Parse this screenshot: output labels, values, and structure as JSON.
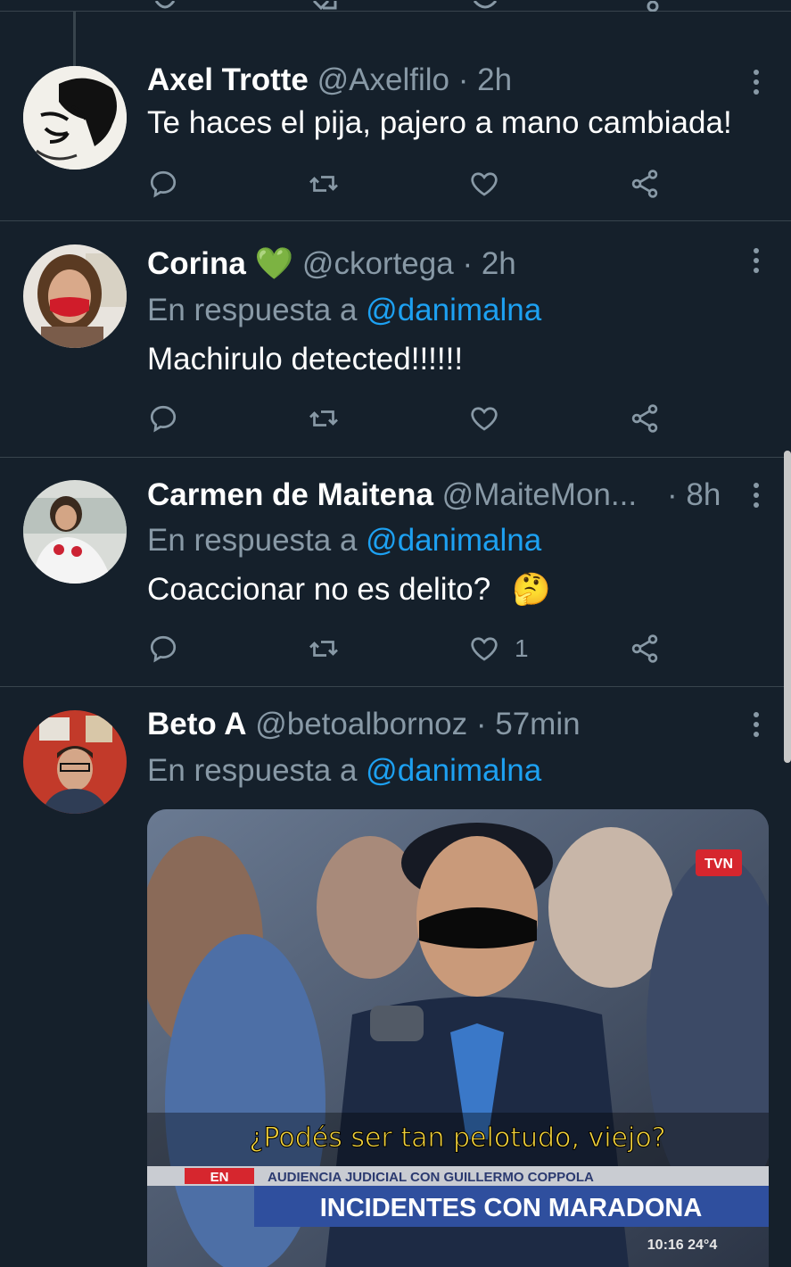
{
  "tweets": [
    {
      "name": "Axel Trotte",
      "handle": "@Axelfilo",
      "time": "· 2h",
      "text": "Te haces el pija, pajero a mano cambiada!",
      "likes": ""
    },
    {
      "name": "Corina",
      "badge": "💚",
      "handle": "@ckortega",
      "time": "· 2h",
      "reply_prefix": "En respuesta a",
      "reply_to": "@danimalna",
      "text": "Machirulo detected!!!!!!",
      "likes": ""
    },
    {
      "name": "Carmen de Maitena",
      "handle": "@MaiteMon...",
      "time": "· 8h",
      "reply_prefix": "En respuesta a",
      "reply_to": "@danimalna",
      "text": "Coaccionar no es delito?",
      "emoji": "🤔",
      "likes": "1"
    },
    {
      "name": "Beto A",
      "handle": "@betoalbornoz",
      "time": "· 57min",
      "reply_prefix": "En respuesta a",
      "reply_to": "@danimalna",
      "media": {
        "channel_logo": "TVN",
        "subtitle": "¿Podés ser tan pelotudo, viejo?",
        "ticker_source": "EN",
        "ticker_line1": "AUDIENCIA JUDICIAL CON GUILLERMO COPPOLA",
        "ticker_line2": "INCIDENTES CON MARADONA",
        "clock": "10:16  24°4"
      }
    }
  ],
  "icons": [
    "reply-icon",
    "retweet-icon",
    "like-icon",
    "share-icon",
    "more-icon"
  ],
  "colors": {
    "background": "#15202b",
    "secondary_text": "#8899a6",
    "link": "#1da1f2",
    "divider": "#38444d"
  }
}
